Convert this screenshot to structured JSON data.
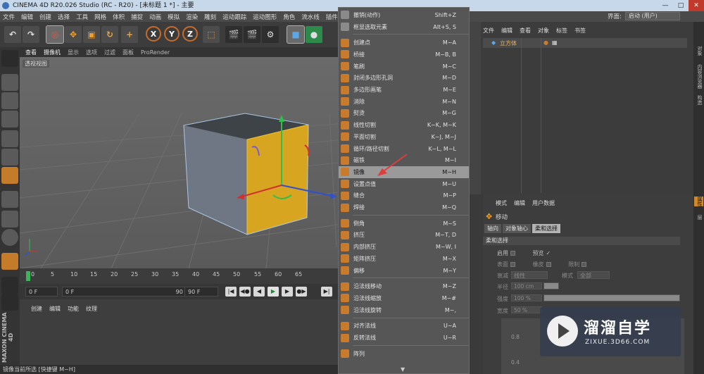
{
  "window": {
    "title": "CINEMA 4D R20.026 Studio (RC - R20) - [未标题 1 *] - 主要",
    "controls": [
      "—",
      "□",
      "✕"
    ]
  },
  "menubar": [
    "文件",
    "编辑",
    "创建",
    "选择",
    "工具",
    "网格",
    "体积",
    "捕捉",
    "动画",
    "模拟",
    "渲染",
    "雕刻",
    "运动跟踪",
    "运动图形",
    "角色",
    "流水线",
    "插件"
  ],
  "layout": {
    "label": "界面:",
    "value": "启动 (用户)"
  },
  "toolbar": {
    "axis_x": "X",
    "axis_y": "Y",
    "axis_z": "Z",
    "icons": [
      "undo-icon",
      "redo-icon",
      "live-select-icon",
      "move-icon",
      "scale-icon",
      "rotate-icon",
      "add-icon",
      "coordinate-system-icon",
      "render-view-icon",
      "render-picture-icon",
      "render-settings-icon",
      "cube-icon"
    ]
  },
  "viewport": {
    "menu": [
      "查看",
      "摄像机",
      "显示",
      "选项",
      "过滤",
      "面板",
      "ProRender"
    ],
    "label": "透视视图"
  },
  "timeline": {
    "ticks": [
      "0",
      "5",
      "10",
      "15",
      "20",
      "25",
      "30",
      "35",
      "40",
      "45",
      "50",
      "55",
      "60",
      "65"
    ],
    "start": "0 F",
    "current": "0 F",
    "range_end": "90 F",
    "end": "90 F"
  },
  "material": {
    "tabs": [
      "创建",
      "编辑",
      "功能",
      "纹理"
    ]
  },
  "status": "镜像当前所选 [快捷键 M~H]",
  "brand": "MAXON CINEMA 4D",
  "context_menu": {
    "items": [
      {
        "label": "撤销(动作)",
        "shortcut": "Shift+Z"
      },
      {
        "label": "框显选取元素",
        "shortcut": "Alt+S, S"
      },
      {
        "label": "创建点",
        "shortcut": "M~A"
      },
      {
        "label": "桥接",
        "shortcut": "M~B, B"
      },
      {
        "label": "笔刷",
        "shortcut": "M~C"
      },
      {
        "label": "封闭多边形孔洞",
        "shortcut": "M~D"
      },
      {
        "label": "多边形画笔",
        "shortcut": "M~E"
      },
      {
        "label": "消除",
        "shortcut": "M~N"
      },
      {
        "label": "熨烫",
        "shortcut": "M~G"
      },
      {
        "label": "线性切割",
        "shortcut": "K~K, M~K"
      },
      {
        "label": "平面切割",
        "shortcut": "K~J, M~J"
      },
      {
        "label": "循环/路径切割",
        "shortcut": "K~L, M~L"
      },
      {
        "label": "磁铁",
        "shortcut": "M~I"
      },
      {
        "label": "镜像",
        "shortcut": "M~H"
      },
      {
        "label": "设置点值",
        "shortcut": "M~U"
      },
      {
        "label": "缝合",
        "shortcut": "M~P"
      },
      {
        "label": "焊接",
        "shortcut": "M~Q"
      },
      {
        "label": "倒角",
        "shortcut": "M~S"
      },
      {
        "label": "挤压",
        "shortcut": "M~T, D"
      },
      {
        "label": "内部挤压",
        "shortcut": "M~W, I"
      },
      {
        "label": "矩阵挤压",
        "shortcut": "M~X"
      },
      {
        "label": "偏移",
        "shortcut": "M~Y"
      },
      {
        "label": "沿法线移动",
        "shortcut": "M~Z"
      },
      {
        "label": "沿法线缩放",
        "shortcut": "M~#"
      },
      {
        "label": "沿法线旋转",
        "shortcut": "M~,"
      },
      {
        "label": "对齐法线",
        "shortcut": "U~A"
      },
      {
        "label": "反转法线",
        "shortcut": "U~R"
      },
      {
        "label": "阵列",
        "shortcut": ""
      }
    ],
    "highlighted_index": 13,
    "more": "▼"
  },
  "object_manager": {
    "menu": [
      "文件",
      "编辑",
      "查看",
      "对象",
      "标签",
      "书签"
    ],
    "objects": [
      {
        "name": "立方体"
      }
    ]
  },
  "right_tabs": [
    "对象",
    "内容浏览器",
    "构造",
    "属性",
    "层"
  ],
  "attributes": {
    "menu": [
      "模式",
      "编辑",
      "用户数据"
    ],
    "title": "移动",
    "tabs": [
      "轴向",
      "对象轴心",
      "柔和选择"
    ],
    "active_tab": "柔和选择",
    "section": "柔和选择",
    "rows": {
      "enable": "启用",
      "preview": "预览",
      "surface": "表面",
      "rubber": "橡皮",
      "restrict": "限制",
      "falloff": "衰减",
      "falloff_value": "线性",
      "mode": "模式",
      "mode_value": "全部",
      "radius": "半径",
      "radius_value": "100 cm",
      "strength": "强度",
      "strength_value": "100 %",
      "width": "宽度",
      "width_value": "50 %"
    },
    "graph_labels": [
      "0.8",
      "0.4"
    ]
  },
  "watermark": {
    "brand": "溜溜自学",
    "url": "ZIXUE.3D66.COM"
  },
  "colors": {
    "accent": "#c87b2c",
    "highlight": "#9a9a9a",
    "cube_selected": "#d8a520"
  }
}
